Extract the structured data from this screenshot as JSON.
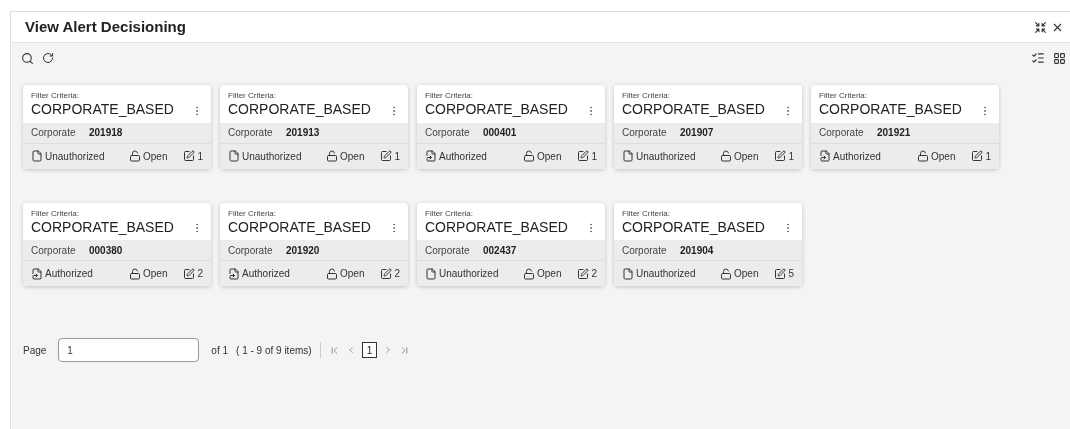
{
  "header": {
    "title": "View Alert Decisioning"
  },
  "cards": [
    {
      "label": "Filter Criteria:",
      "title": "CORPORATE_BASED",
      "field": "Corporate",
      "value": "201918",
      "status": "Unauthorized",
      "authorized": false,
      "lock": "Open",
      "count": "1"
    },
    {
      "label": "Filter Criteria:",
      "title": "CORPORATE_BASED",
      "field": "Corporate",
      "value": "201913",
      "status": "Unauthorized",
      "authorized": false,
      "lock": "Open",
      "count": "1"
    },
    {
      "label": "Filter Criteria:",
      "title": "CORPORATE_BASED",
      "field": "Corporate",
      "value": "000401",
      "status": "Authorized",
      "authorized": true,
      "lock": "Open",
      "count": "1"
    },
    {
      "label": "Filter Criteria:",
      "title": "CORPORATE_BASED",
      "field": "Corporate",
      "value": "201907",
      "status": "Unauthorized",
      "authorized": false,
      "lock": "Open",
      "count": "1"
    },
    {
      "label": "Filter Criteria:",
      "title": "CORPORATE_BASED",
      "field": "Corporate",
      "value": "201921",
      "status": "Authorized",
      "authorized": true,
      "lock": "Open",
      "count": "1"
    },
    {
      "label": "Filter Criteria:",
      "title": "CORPORATE_BASED",
      "field": "Corporate",
      "value": "000380",
      "status": "Authorized",
      "authorized": true,
      "lock": "Open",
      "count": "2"
    },
    {
      "label": "Filter Criteria:",
      "title": "CORPORATE_BASED",
      "field": "Corporate",
      "value": "201920",
      "status": "Authorized",
      "authorized": true,
      "lock": "Open",
      "count": "2"
    },
    {
      "label": "Filter Criteria:",
      "title": "CORPORATE_BASED",
      "field": "Corporate",
      "value": "002437",
      "status": "Unauthorized",
      "authorized": false,
      "lock": "Open",
      "count": "2"
    },
    {
      "label": "Filter Criteria:",
      "title": "CORPORATE_BASED",
      "field": "Corporate",
      "value": "201904",
      "status": "Unauthorized",
      "authorized": false,
      "lock": "Open",
      "count": "5"
    }
  ],
  "pagination": {
    "label": "Page",
    "value": "1",
    "of": "of 1",
    "range": "( 1 - 9 of 9 items)",
    "pages": [
      {
        "label": "1",
        "selected": true
      }
    ]
  }
}
